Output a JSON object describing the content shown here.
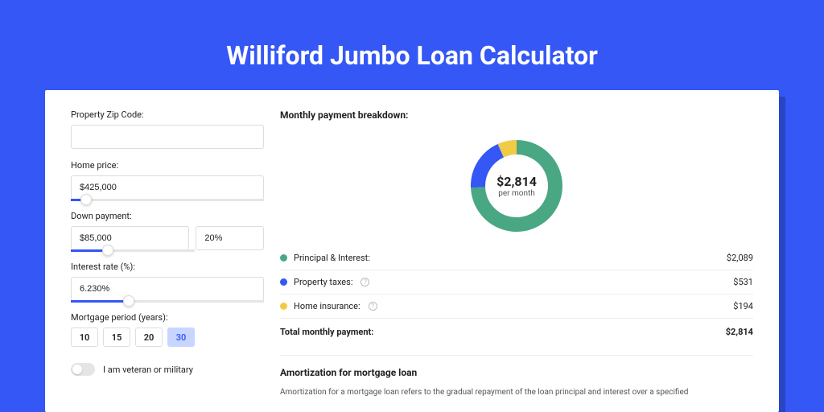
{
  "title": "Williford Jumbo Loan Calculator",
  "colors": {
    "green": "#4aa784",
    "blue": "#3457f5",
    "yellow": "#f2cb46"
  },
  "form": {
    "zip": {
      "label": "Property Zip Code:",
      "value": ""
    },
    "price": {
      "label": "Home price:",
      "value": "$425,000",
      "slider_pct": 8
    },
    "down": {
      "label": "Down payment:",
      "value": "$85,000",
      "pct": "20%",
      "slider_pct": 20
    },
    "rate": {
      "label": "Interest rate (%):",
      "value": "6.230%",
      "slider_pct": 30
    },
    "period": {
      "label": "Mortgage period (years):",
      "options": [
        "10",
        "15",
        "20",
        "30"
      ],
      "selected": "30"
    },
    "veteran": {
      "label": "I am veteran or military",
      "value": false
    }
  },
  "breakdown": {
    "title": "Monthly payment breakdown:",
    "center_amount": "$2,814",
    "center_sub": "per month",
    "items": [
      {
        "label": "Principal & Interest:",
        "value": "$2,089",
        "color": "green",
        "info": false
      },
      {
        "label": "Property taxes:",
        "value": "$531",
        "color": "blue",
        "info": true
      },
      {
        "label": "Home insurance:",
        "value": "$194",
        "color": "yellow",
        "info": true
      }
    ],
    "total": {
      "label": "Total monthly payment:",
      "value": "$2,814"
    }
  },
  "amortization": {
    "title": "Amortization for mortgage loan",
    "text": "Amortization for a mortgage loan refers to the gradual repayment of the loan principal and interest over a specified"
  },
  "chart_data": {
    "type": "pie",
    "title": "Monthly payment breakdown",
    "series": [
      {
        "name": "Principal & Interest",
        "value": 2089,
        "color": "#4aa784"
      },
      {
        "name": "Property taxes",
        "value": 531,
        "color": "#3457f5"
      },
      {
        "name": "Home insurance",
        "value": 194,
        "color": "#f2cb46"
      }
    ],
    "center_label": "$2,814 per month",
    "total": 2814
  }
}
